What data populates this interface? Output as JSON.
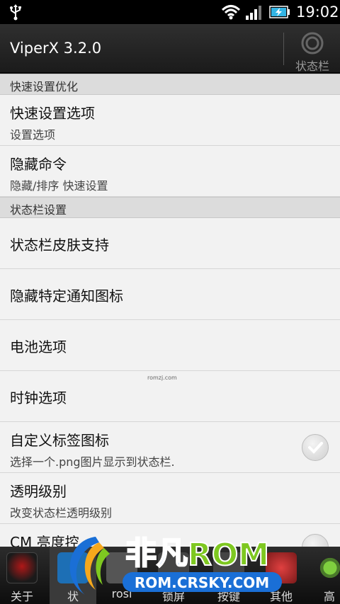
{
  "status": {
    "time": "19:02"
  },
  "app": {
    "title": "ViperX 3.2.0",
    "action_label": "状态栏"
  },
  "sections": [
    {
      "header": "快速设置优化"
    },
    {
      "header": "状态栏设置"
    }
  ],
  "items": [
    {
      "title": "快速设置选项",
      "subtitle": "设置选项"
    },
    {
      "title": "隐藏命令",
      "subtitle": "隐藏/排序 快速设置"
    },
    {
      "title": "状态栏皮肤支持"
    },
    {
      "title": "隐藏特定通知图标"
    },
    {
      "title": "电池选项"
    },
    {
      "title": "时钟选项"
    },
    {
      "title": "自定义标签图标",
      "subtitle": "选择一个.png图片显示到状态栏."
    },
    {
      "title": "透明级别",
      "subtitle": "改变状态栏透明级别"
    },
    {
      "title": "CM 亮度控"
    }
  ],
  "watermark": "romzj.com",
  "bottom_tabs": [
    {
      "label": "关于",
      "icon": "about-icon"
    },
    {
      "label": "状",
      "icon": "status-tab-icon"
    },
    {
      "label": "rosi",
      "icon": "rosi-icon"
    },
    {
      "label": "锁屏",
      "icon": "lockscreen-icon"
    },
    {
      "label": "按键",
      "icon": "keys-icon"
    },
    {
      "label": "其他",
      "icon": "other-icon"
    },
    {
      "label": "高级",
      "icon": "gear-icon"
    }
  ],
  "logo": {
    "cn": "非凡",
    "rom": "ROM",
    "url": "ROM.CRSKY.COM"
  },
  "colors": {
    "accent": "#33b5e5",
    "logo_green": "#7ec820",
    "logo_blue": "#1a6fd6"
  }
}
